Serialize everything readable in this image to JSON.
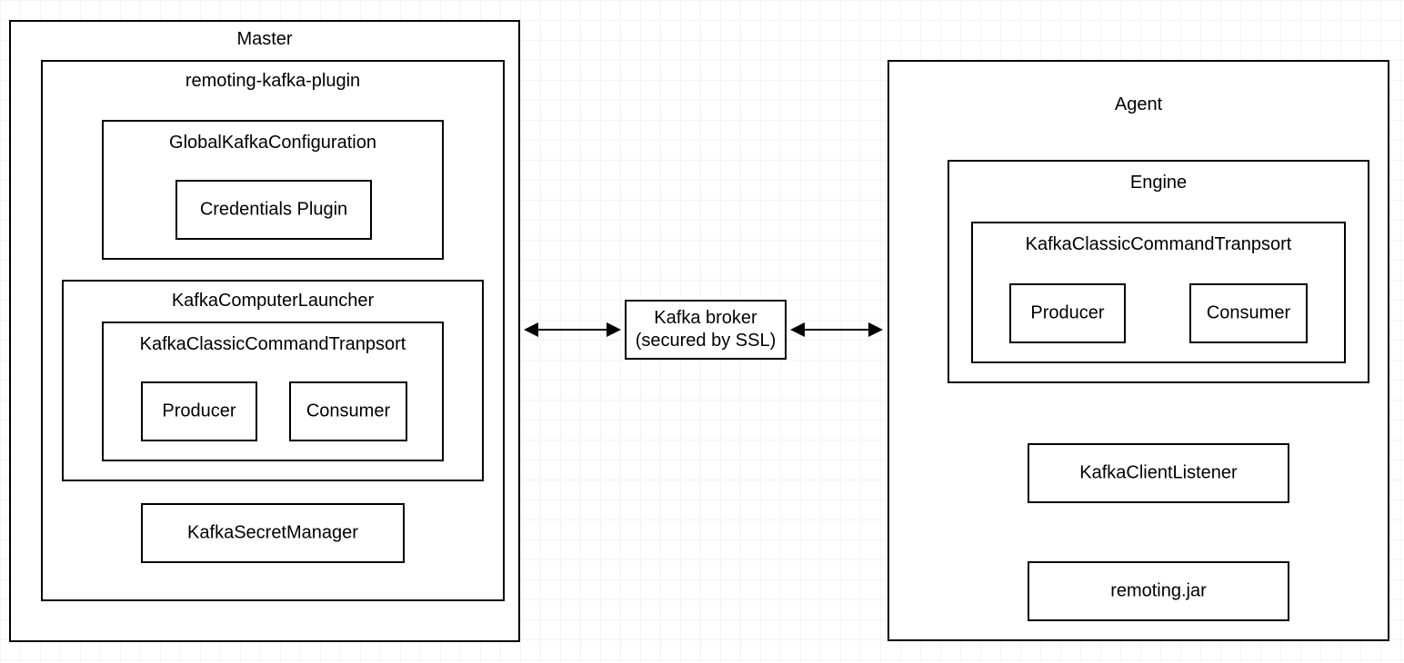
{
  "master": {
    "title": "Master",
    "plugin": {
      "title": "remoting-kafka-plugin",
      "globalConfig": {
        "title": "GlobalKafkaConfiguration",
        "credentials": "Credentials Plugin"
      },
      "launcher": {
        "title": "KafkaComputerLauncher",
        "transport": {
          "title": "KafkaClassicCommandTranpsort",
          "producer": "Producer",
          "consumer": "Consumer"
        }
      },
      "secretManager": "KafkaSecretManager"
    }
  },
  "broker": {
    "line1": "Kafka broker",
    "line2": "(secured by SSL)"
  },
  "agent": {
    "title": "Agent",
    "engine": {
      "title": "Engine",
      "transport": {
        "title": "KafkaClassicCommandTranpsort",
        "producer": "Producer",
        "consumer": "Consumer"
      }
    },
    "clientListener": "KafkaClientListener",
    "remotingJar": "remoting.jar"
  }
}
